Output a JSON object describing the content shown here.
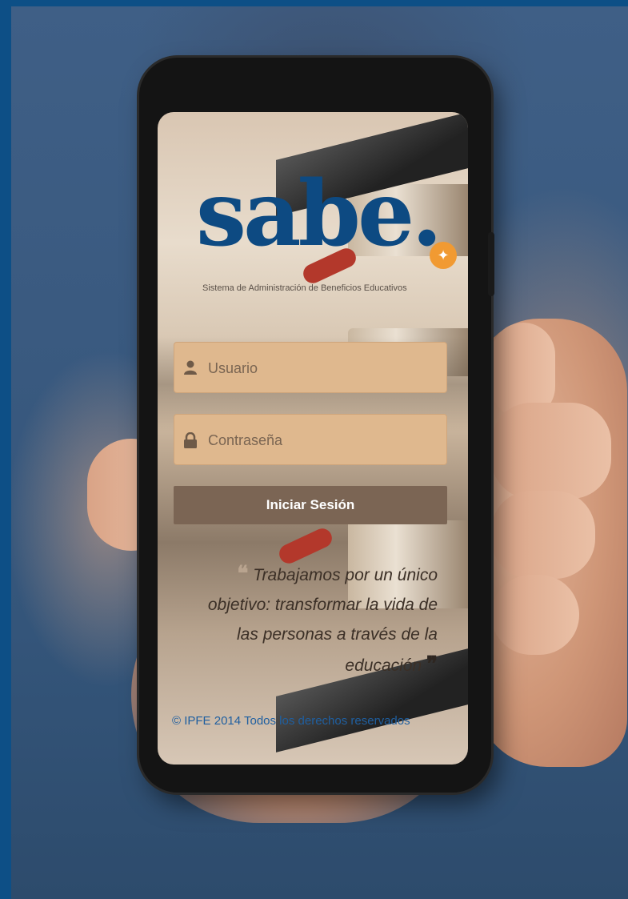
{
  "app": {
    "logo_text": "sabe.",
    "logo_subtitle": "Sistema de Administración de Beneficios Educativos"
  },
  "login": {
    "username_placeholder": "Usuario",
    "password_placeholder": "Contraseña",
    "submit_label": "Iniciar Sesión"
  },
  "quote": {
    "open_mark": "❝",
    "text": "Trabajamos por un único objetivo: transformar la vida de las personas a través de la educación",
    "close_mark": "❞"
  },
  "footer": {
    "copyright": "© IPFE 2014 Todos los derechos reservados"
  },
  "colors": {
    "brand_blue": "#0d4a82",
    "accent_orange": "#f19a32",
    "field_bg": "#dfb88e",
    "button_bg": "#7b6554"
  },
  "icons": {
    "username": "user-icon",
    "password": "lock-icon"
  }
}
